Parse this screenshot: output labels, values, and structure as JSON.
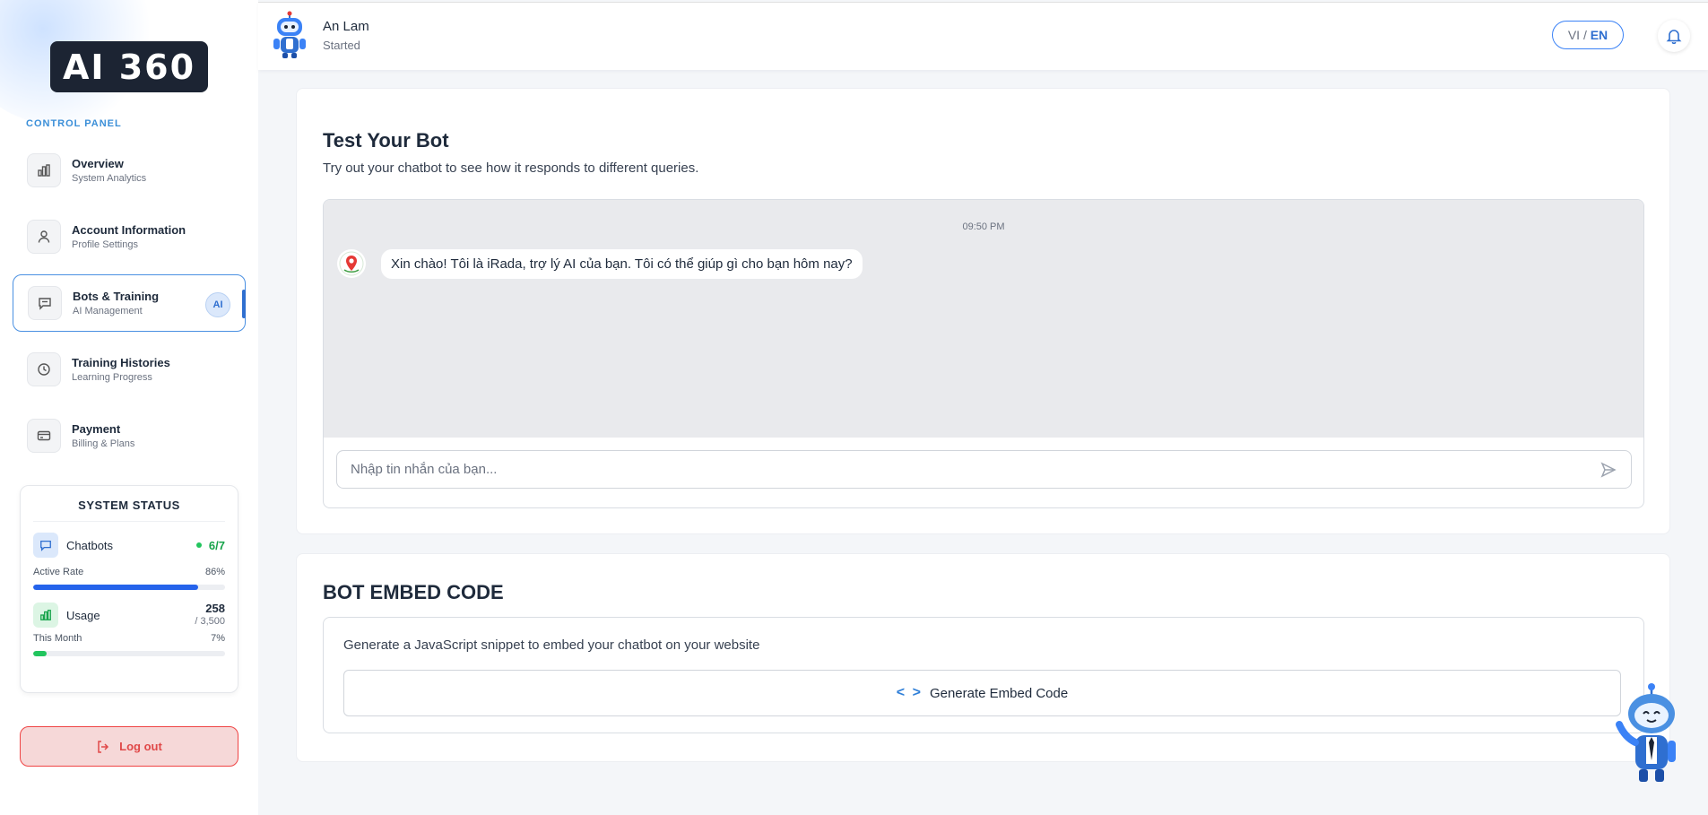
{
  "brand": {
    "logo_text": "AI 360"
  },
  "sidebar": {
    "section_label": "CONTROL PANEL",
    "items": [
      {
        "title": "Overview",
        "subtitle": "System Analytics",
        "icon": "bar-chart-icon"
      },
      {
        "title": "Account Information",
        "subtitle": "Profile Settings",
        "icon": "user-icon"
      },
      {
        "title": "Bots & Training",
        "subtitle": "AI Management",
        "icon": "chat-icon",
        "badge": "AI",
        "active": true
      },
      {
        "title": "Training Histories",
        "subtitle": "Learning Progress",
        "icon": "clock-icon"
      },
      {
        "title": "Payment",
        "subtitle": "Billing & Plans",
        "icon": "credit-card-icon"
      }
    ],
    "status": {
      "title": "SYSTEM STATUS",
      "chatbots": {
        "label": "Chatbots",
        "value": "6/7",
        "meta_label": "Active Rate",
        "meta_value": "86%",
        "progress": 0.86,
        "color": "#2563eb"
      },
      "usage": {
        "label": "Usage",
        "value": "258",
        "limit": "/ 3,500",
        "meta_label": "This Month",
        "meta_value": "7%",
        "progress": 0.07,
        "color": "#22c55e"
      }
    },
    "logout_label": "Log out"
  },
  "header": {
    "user_name": "An Lam",
    "user_status": "Started",
    "lang": {
      "vi": "VI",
      "sep": "/",
      "en": "EN"
    }
  },
  "test_bot": {
    "title": "Test Your Bot",
    "description": "Try out your chatbot to see how it responds to different queries.",
    "timestamp": "09:50 PM",
    "bot_message": "Xin chào! Tôi là iRada, trợ lý AI của bạn. Tôi có thể giúp gì cho bạn hôm nay?",
    "input_placeholder": "Nhập tin nhắn của bạn..."
  },
  "embed": {
    "title": "BOT EMBED CODE",
    "description": "Generate a JavaScript snippet to embed your chatbot on your website",
    "button_label": "Generate Embed Code",
    "button_icon": "< >"
  },
  "colors": {
    "accent": "#2f6fd0",
    "danger": "#ef4444",
    "success": "#22c55e"
  }
}
